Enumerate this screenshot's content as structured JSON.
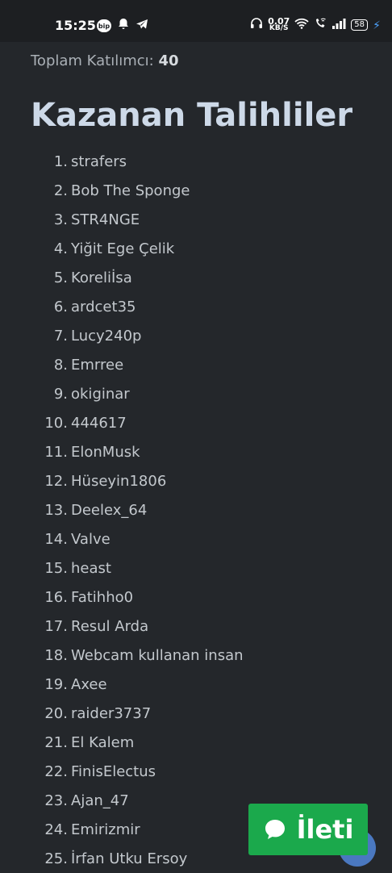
{
  "status_bar": {
    "time": "15:25",
    "bip_label": "bip",
    "speed_value": "0.07",
    "speed_unit": "KB/S",
    "battery": "58",
    "icons": [
      "bip-icon",
      "bell-icon",
      "telegram-icon",
      "headphones-icon",
      "wifi-icon",
      "wifi-call-icon",
      "signal-icon",
      "battery-icon",
      "charging-icon"
    ]
  },
  "summary": {
    "label": "Toplam Katılımcı:",
    "count": "40"
  },
  "heading": "Kazanan Talihliler",
  "winners": [
    {
      "n": "1.",
      "name": "strafers"
    },
    {
      "n": "2.",
      "name": "Bob The Sponge"
    },
    {
      "n": "3.",
      "name": "STR4NGE"
    },
    {
      "n": "4.",
      "name": "Yiğit Ege Çelik"
    },
    {
      "n": "5.",
      "name": "Koreliİsa"
    },
    {
      "n": "6.",
      "name": "ardcet35"
    },
    {
      "n": "7.",
      "name": "Lucy240p"
    },
    {
      "n": "8.",
      "name": "Emrree"
    },
    {
      "n": "9.",
      "name": "okiginar"
    },
    {
      "n": "10.",
      "name": "444617"
    },
    {
      "n": "11.",
      "name": "ElonMusk"
    },
    {
      "n": "12.",
      "name": "Hüseyin1806"
    },
    {
      "n": "13.",
      "name": "Deelex_64"
    },
    {
      "n": "14.",
      "name": "Valve"
    },
    {
      "n": "15.",
      "name": "heast"
    },
    {
      "n": "16.",
      "name": "Fatihho0"
    },
    {
      "n": "17.",
      "name": "Resul Arda"
    },
    {
      "n": "18.",
      "name": "Webcam kullanan insan"
    },
    {
      "n": "19.",
      "name": "Axee"
    },
    {
      "n": "20.",
      "name": "raider3737"
    },
    {
      "n": "21.",
      "name": "El Kalem"
    },
    {
      "n": "22.",
      "name": "FinisElectus"
    },
    {
      "n": "23.",
      "name": "Ajan_47"
    },
    {
      "n": "24.",
      "name": "Emirizmir"
    },
    {
      "n": "25.",
      "name": "İrfan Utku Ersoy"
    }
  ],
  "message_button": {
    "label": "İleti",
    "icon": "chat-bubble-icon",
    "color": "#1ba94c"
  },
  "colors": {
    "background": "#24272b",
    "heading": "#cdd9e8",
    "text": "#c3c8cd"
  }
}
